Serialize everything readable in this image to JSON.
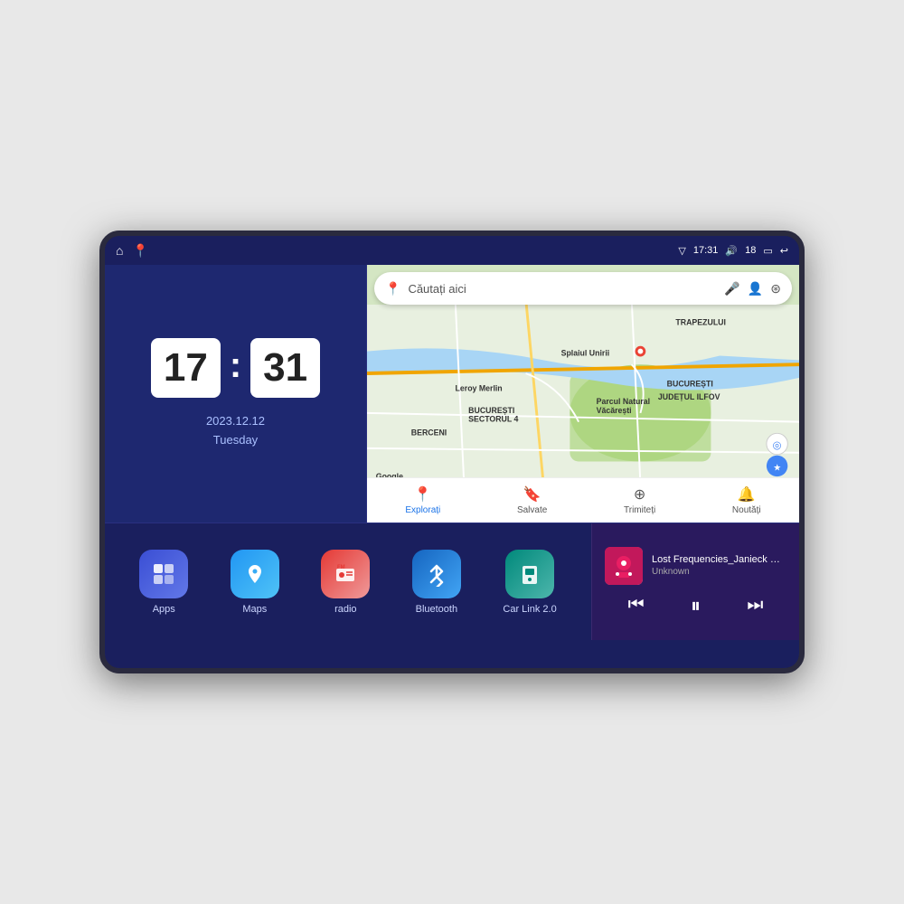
{
  "device": {
    "screen_bg": "#1a1f5e"
  },
  "status_bar": {
    "signal_icon": "▽",
    "time": "17:31",
    "volume_icon": "🔊",
    "battery_level": "18",
    "battery_icon": "▭",
    "back_icon": "↩"
  },
  "clock": {
    "hours": "17",
    "minutes": "31",
    "date": "2023.12.12",
    "day": "Tuesday"
  },
  "map": {
    "search_placeholder": "Căutați aici",
    "nav_items": [
      {
        "label": "Explorați",
        "icon": "📍",
        "active": true
      },
      {
        "label": "Salvate",
        "icon": "🔖",
        "active": false
      },
      {
        "label": "Trimiteți",
        "icon": "⊕",
        "active": false
      },
      {
        "label": "Noutăți",
        "icon": "🔔",
        "active": false
      }
    ],
    "labels": {
      "trapezului": "TRAPEZULUI",
      "bucuresti": "BUCUREȘTI",
      "judetul_ilfov": "JUDEȚUL ILFOV",
      "berceni": "BERCENI",
      "splaiul": "Splaiul Unirii",
      "leroy": "Leroy Merlin",
      "parcul": "Parcul Natural Văcărești",
      "sector4": "BUCUREȘTI\nSECTORUL 4",
      "google": "Google"
    }
  },
  "apps": [
    {
      "id": "apps",
      "label": "Apps",
      "icon": "⊞",
      "color_class": "app-apps"
    },
    {
      "id": "maps",
      "label": "Maps",
      "icon": "📍",
      "color_class": "app-maps"
    },
    {
      "id": "radio",
      "label": "radio",
      "icon": "📻",
      "color_class": "app-radio"
    },
    {
      "id": "bluetooth",
      "label": "Bluetooth",
      "icon": "🔷",
      "color_class": "app-bt"
    },
    {
      "id": "carlink",
      "label": "Car Link 2.0",
      "icon": "📱",
      "color_class": "app-carlink"
    }
  ],
  "music": {
    "title": "Lost Frequencies_Janieck Devy-...",
    "artist": "Unknown",
    "controls": {
      "prev": "⏮",
      "play": "⏸",
      "next": "⏭"
    }
  }
}
